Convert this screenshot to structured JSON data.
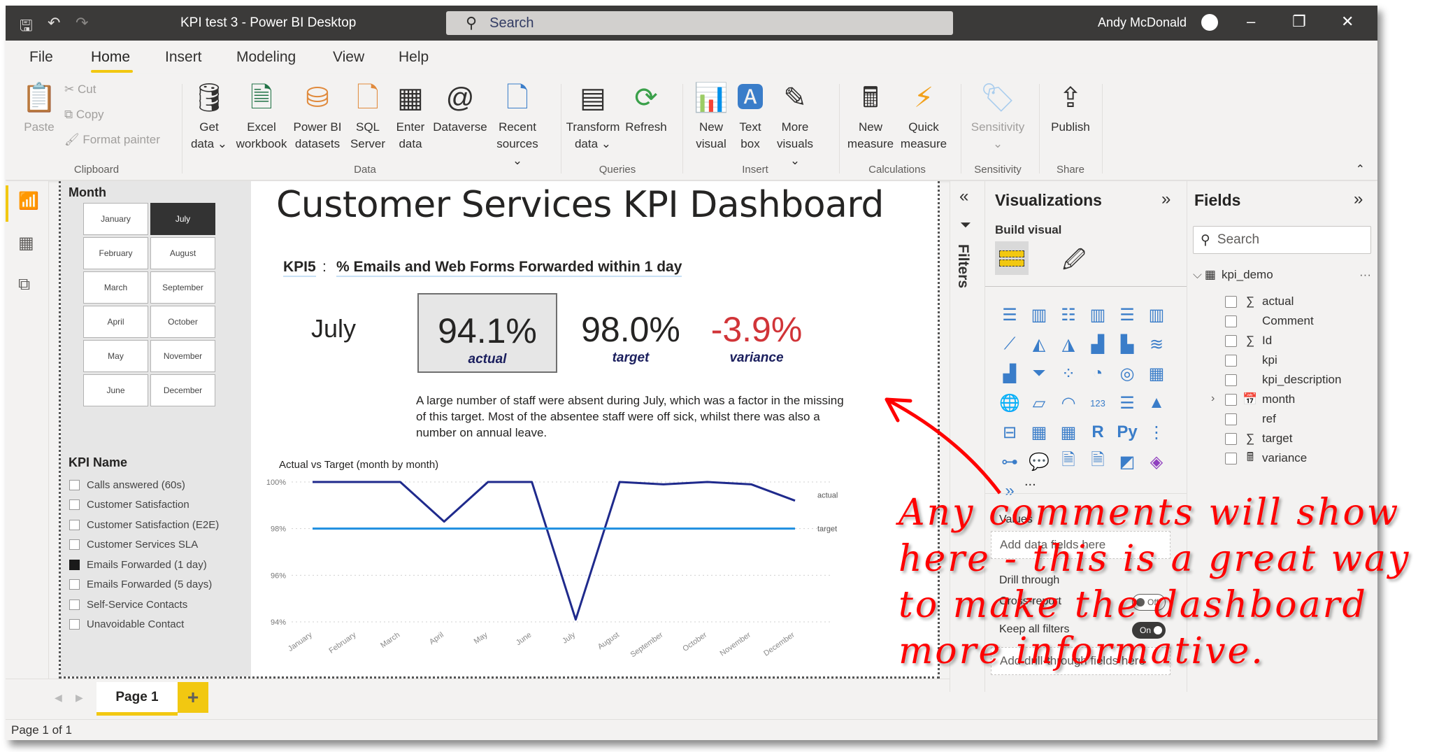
{
  "window": {
    "title": "KPI test 3 - Power BI Desktop",
    "search_placeholder": "Search",
    "user": "Andy McDonald",
    "icons": [
      "save-icon",
      "undo-icon",
      "redo-icon"
    ],
    "controls": [
      "minimize",
      "restore",
      "close"
    ]
  },
  "menu": {
    "items": [
      "File",
      "Home",
      "Insert",
      "Modeling",
      "View",
      "Help"
    ],
    "active": "Home"
  },
  "ribbon": {
    "clipboard": {
      "paste": "Paste",
      "cut": "Cut",
      "copy": "Copy",
      "format_painter": "Format painter",
      "label": "Clipboard"
    },
    "data": {
      "buttons": [
        {
          "l1": "Get",
          "l2": "data ⌄"
        },
        {
          "l1": "Excel",
          "l2": "workbook"
        },
        {
          "l1": "Power BI",
          "l2": "datasets"
        },
        {
          "l1": "SQL",
          "l2": "Server"
        },
        {
          "l1": "Enter",
          "l2": "data"
        },
        {
          "l1": "Dataverse",
          "l2": ""
        },
        {
          "l1": "Recent",
          "l2": "sources ⌄"
        }
      ],
      "label": "Data"
    },
    "queries": {
      "buttons": [
        {
          "l1": "Transform",
          "l2": "data ⌄"
        },
        {
          "l1": "Refresh",
          "l2": ""
        }
      ],
      "label": "Queries"
    },
    "insert": {
      "buttons": [
        {
          "l1": "New",
          "l2": "visual"
        },
        {
          "l1": "Text",
          "l2": "box"
        },
        {
          "l1": "More",
          "l2": "visuals ⌄"
        }
      ],
      "label": "Insert"
    },
    "calculations": {
      "buttons": [
        {
          "l1": "New",
          "l2": "measure"
        },
        {
          "l1": "Quick",
          "l2": "measure"
        }
      ],
      "label": "Calculations"
    },
    "sensitivity": {
      "button": "Sensitivity",
      "sub": "⌄",
      "label": "Sensitivity"
    },
    "share": {
      "button": "Publish",
      "label": "Share"
    }
  },
  "slicers": {
    "month": {
      "title": "Month",
      "options": [
        "January",
        "July",
        "February",
        "August",
        "March",
        "September",
        "April",
        "October",
        "May",
        "November",
        "June",
        "December"
      ],
      "selected": "July"
    },
    "kpi_name": {
      "title": "KPI Name",
      "options": [
        {
          "label": "Calls answered (60s)",
          "checked": false
        },
        {
          "label": "Customer Satisfaction",
          "checked": false
        },
        {
          "label": "Customer Satisfaction (E2E)",
          "checked": false
        },
        {
          "label": "Customer Services SLA",
          "checked": false
        },
        {
          "label": "Emails Forwarded (1 day)",
          "checked": true
        },
        {
          "label": "Emails Forwarded (5 days)",
          "checked": false
        },
        {
          "label": "Self-Service Contacts",
          "checked": false
        },
        {
          "label": "Unavoidable Contact",
          "checked": false
        }
      ]
    }
  },
  "dashboard": {
    "title": "Customer Services KPI Dashboard",
    "kpi_code": "KPI5",
    "kpi_colon": ":",
    "kpi_description": "% Emails and Web Forms Forwarded within 1 day",
    "selected_month": "July",
    "cards": {
      "actual": {
        "value": "94.1%",
        "label": "actual"
      },
      "target": {
        "value": "98.0%",
        "label": "target"
      },
      "variance": {
        "value": "-3.9%",
        "label": "variance",
        "color": "#d13438"
      }
    },
    "comment": "A large number of staff were absent during July, which was a factor in the missing of this target. Most of the absentee staff were off sick, whilst there was also a number on annual leave."
  },
  "chart_data": {
    "type": "line",
    "title": "Actual vs Target (month by month)",
    "categories": [
      "January",
      "February",
      "March",
      "April",
      "May",
      "June",
      "July",
      "August",
      "September",
      "October",
      "November",
      "December"
    ],
    "series": [
      {
        "name": "actual",
        "color": "#1f2a8c",
        "values": [
          100,
          100,
          100,
          98.3,
          100,
          100,
          94.1,
          100,
          99.9,
          100,
          99.9,
          99.2
        ]
      },
      {
        "name": "target",
        "color": "#1e8fe0",
        "values": [
          98,
          98,
          98,
          98,
          98,
          98,
          98,
          98,
          98,
          98,
          98,
          98
        ]
      }
    ],
    "yticks": [
      "94%",
      "96%",
      "98%",
      "100%"
    ],
    "ylim": [
      94,
      100
    ],
    "grid": true,
    "legend": "right (end-of-line labels)",
    "xlabel": "",
    "ylabel": ""
  },
  "filters_pane": {
    "label": "Filters"
  },
  "visualizations": {
    "title": "Visualizations",
    "build_visual": "Build visual",
    "icons": [
      "stacked-bar",
      "stacked-column",
      "clustered-bar",
      "clustered-column",
      "100-stacked-bar",
      "100-stacked-column",
      "line",
      "area",
      "stacked-area",
      "line-stacked-column",
      "line-clustered-column",
      "ribbon",
      "waterfall",
      "funnel",
      "scatter",
      "pie",
      "donut",
      "treemap",
      "map",
      "filled-map",
      "gauge",
      "card",
      "multi-row-card",
      "kpi",
      "slicer",
      "table",
      "matrix",
      "r-visual",
      "python-visual",
      "key-influencers",
      "decomposition-tree",
      "qa",
      "smart-narrative",
      "paginated-report",
      "azure-map",
      "power-apps",
      "power-automate"
    ],
    "more": "...",
    "values_label": "Values",
    "values_placeholder": "Add data fields here",
    "drill_through": "Drill through",
    "cross_report": {
      "label": "Cross-report",
      "state": "Off"
    },
    "keep_all_filters": {
      "label": "Keep all filters",
      "state": "On"
    },
    "drill_placeholder": "Add drill-through fields here"
  },
  "fields": {
    "title": "Fields",
    "search_placeholder": "Search",
    "table": "kpi_demo",
    "items": [
      {
        "name": "actual",
        "type": "sigma"
      },
      {
        "name": "Comment",
        "type": "text"
      },
      {
        "name": "Id",
        "type": "sigma"
      },
      {
        "name": "kpi",
        "type": "text"
      },
      {
        "name": "kpi_description",
        "type": "text"
      },
      {
        "name": "month",
        "type": "date",
        "expandable": true
      },
      {
        "name": "ref",
        "type": "text"
      },
      {
        "name": "target",
        "type": "sigma"
      },
      {
        "name": "variance",
        "type": "measure"
      }
    ]
  },
  "pages": {
    "tabs": [
      "Page 1"
    ],
    "add": "+",
    "status": "Page 1 of 1"
  },
  "annotation": {
    "text": "Any comments will show here - this is a great way to make the dashboard more informative.",
    "color": "#ff0000"
  }
}
